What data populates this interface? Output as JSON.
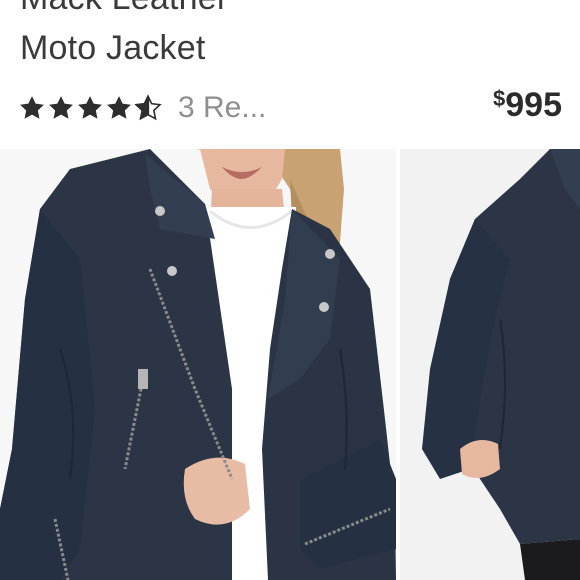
{
  "product": {
    "title_line1": "Mack Leather",
    "title_line2": "Moto Jacket",
    "rating_stars": 4.5,
    "rating_max": 5,
    "review_text": "3 Re...",
    "price_currency": "$",
    "price_amount": "995"
  },
  "gallery": {
    "images": [
      {
        "name": "front-view-photo"
      },
      {
        "name": "back-view-photo"
      }
    ]
  },
  "colors": {
    "star": "#2d2d2d",
    "review_text": "#8f8f8f",
    "jacket": "#2b3546",
    "background": "#ffffff"
  }
}
